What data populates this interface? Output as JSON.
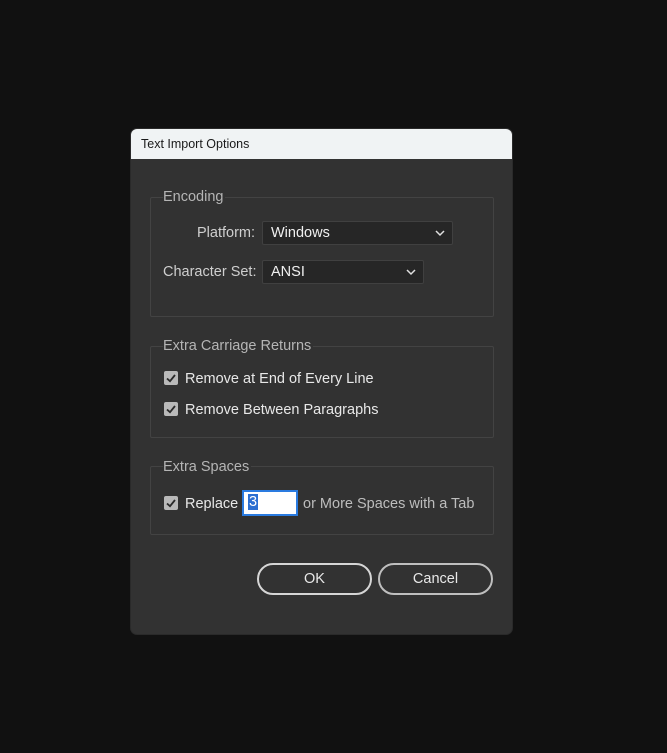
{
  "dialog": {
    "title": "Text Import Options"
  },
  "encoding": {
    "legend": "Encoding",
    "platform_label": "Platform:",
    "platform_value": "Windows",
    "charset_label": "Character Set:",
    "charset_value": "ANSI"
  },
  "carriage_returns": {
    "legend": "Extra Carriage Returns",
    "remove_end_line": "Remove at End of Every Line",
    "remove_end_line_checked": true,
    "remove_between_paragraphs": "Remove Between Paragraphs",
    "remove_between_paragraphs_checked": true
  },
  "spaces": {
    "legend": "Extra Spaces",
    "replace_label": "Replace",
    "replace_checked": true,
    "replace_count": "3",
    "suffix": "or More Spaces with a Tab"
  },
  "buttons": {
    "ok": "OK",
    "cancel": "Cancel"
  },
  "colors": {
    "background": "#111111",
    "dialog": "#323232",
    "titlebar": "#f0f3f4",
    "focus": "#2a7be0"
  },
  "icons": {
    "dropdown": "chevron-down-icon",
    "check": "checkmark-icon"
  }
}
